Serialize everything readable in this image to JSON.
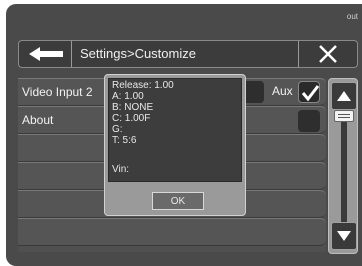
{
  "status": {
    "corner_text": "out"
  },
  "header": {
    "title": "Settings>Customize",
    "back_icon": "arrow-left-icon",
    "close_icon": "close-icon"
  },
  "list": {
    "rows": [
      {
        "label": "Video Input 2"
      },
      {
        "label": "About"
      }
    ],
    "aux": {
      "label": "Aux",
      "checked": true
    }
  },
  "dialog": {
    "release": "Release: 1.00",
    "a": "A: 1.00",
    "b": "B: NONE",
    "c": "C: 1.00F",
    "g": "G:",
    "t": "T: 5:6",
    "vin": "Vin:",
    "ok_label": "OK"
  },
  "colors": {
    "background": "#4a4a4a",
    "header_bg": "#3c3c3c",
    "dialog_frame": "#9a9a9a",
    "dialog_inner": "#3d3d3d",
    "text": "#f2f2f2"
  }
}
